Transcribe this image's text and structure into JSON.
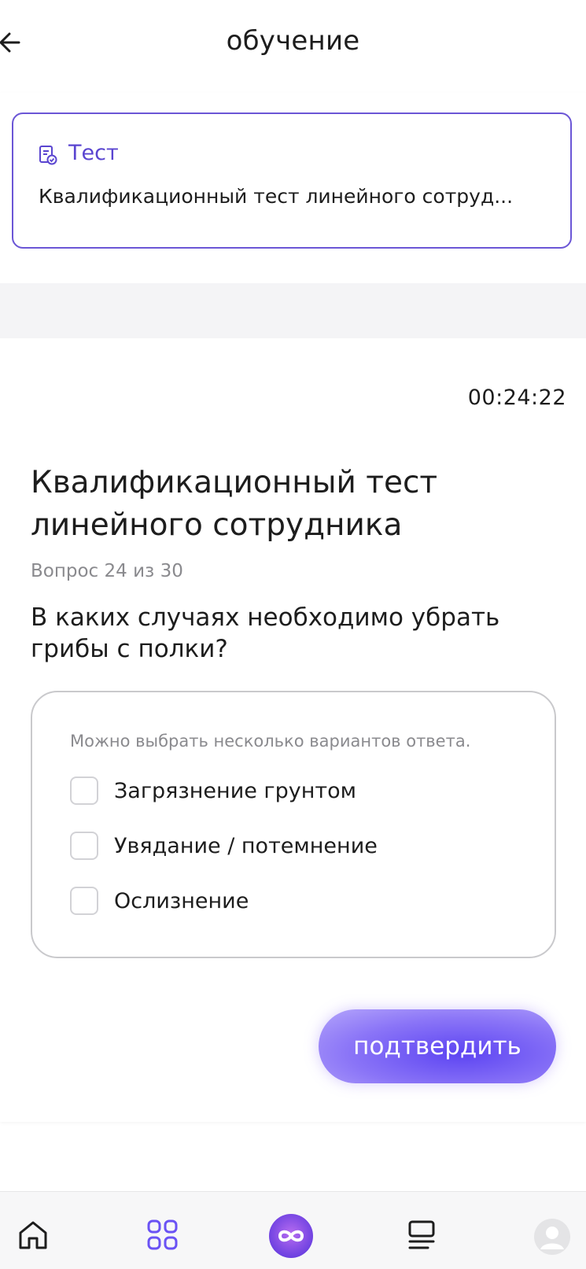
{
  "header": {
    "title": "обучение"
  },
  "test_card": {
    "label": "Тест",
    "name": "Квалификационный тест линейного сотруд..."
  },
  "quiz": {
    "timer": "00:24:22",
    "title": "Квалификационный тест линейного сотрудника",
    "counter": "Вопрос 24 из 30",
    "question": "В каких случаях необходимо убрать грибы с полки?",
    "hint": "Можно выбрать несколько вариантов ответа.",
    "options": [
      {
        "label": "Загрязнение грунтом",
        "checked": false
      },
      {
        "label": "Увядание / потемнение",
        "checked": false
      },
      {
        "label": "Ослизнение",
        "checked": false
      }
    ],
    "confirm_label": "подтвердить"
  },
  "bottom_nav": {
    "items": [
      {
        "icon": "home-icon",
        "active": false
      },
      {
        "icon": "grid-icon",
        "active": true
      },
      {
        "icon": "infinity-icon",
        "active": false
      },
      {
        "icon": "list-icon",
        "active": false
      },
      {
        "icon": "avatar",
        "active": false
      }
    ]
  },
  "colors": {
    "accent": "#6b56d6",
    "button": "#6a52f4",
    "text": "#1d1d1d",
    "muted": "#8a8a8e"
  }
}
